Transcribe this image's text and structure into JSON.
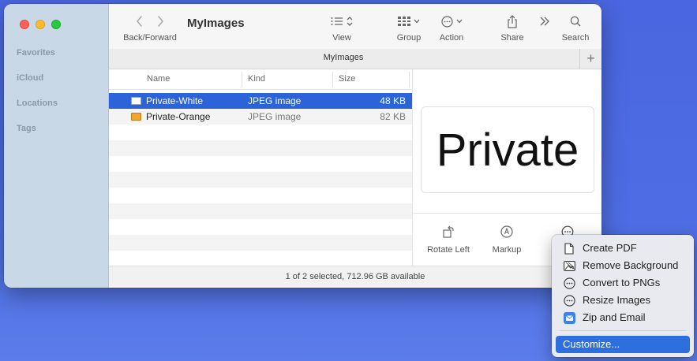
{
  "window": {
    "title": "MyImages",
    "tab_title": "MyImages",
    "tab_add_label": "+"
  },
  "sidebar": {
    "sections": [
      "Favorites",
      "iCloud",
      "Locations",
      "Tags"
    ]
  },
  "toolbar": {
    "back_forward_label": "Back/Forward",
    "view_label": "View",
    "group_label": "Group",
    "action_label": "Action",
    "share_label": "Share",
    "search_label": "Search"
  },
  "file_list": {
    "columns": {
      "name": "Name",
      "kind": "Kind",
      "size": "Size"
    },
    "rows": [
      {
        "name": "Private-White",
        "kind": "JPEG image",
        "size": "48 KB",
        "selected": true,
        "icon_color": "#ffffff"
      },
      {
        "name": "Private-Orange",
        "kind": "JPEG image",
        "size": "82 KB",
        "selected": false,
        "icon_color": "#f2a531"
      }
    ]
  },
  "preview": {
    "image_text": "Private",
    "actions": {
      "rotate_left": "Rotate Left",
      "markup": "Markup"
    }
  },
  "status": {
    "text": "1 of 2 selected, 712.96 GB available"
  },
  "menu": {
    "items": [
      {
        "label": "Create PDF",
        "icon": "document-icon"
      },
      {
        "label": "Remove Background",
        "icon": "photo-icon"
      },
      {
        "label": "Convert to PNGs",
        "icon": "ellipsis-circle-icon"
      },
      {
        "label": "Resize Images",
        "icon": "ellipsis-circle-icon"
      },
      {
        "label": "Zip and Email",
        "icon": "mail-icon"
      }
    ],
    "customize_label": "Customize..."
  },
  "colors": {
    "selection": "#2b63d9",
    "menu_highlight": "#2e6fe0",
    "desktop": "#4e6de4"
  }
}
